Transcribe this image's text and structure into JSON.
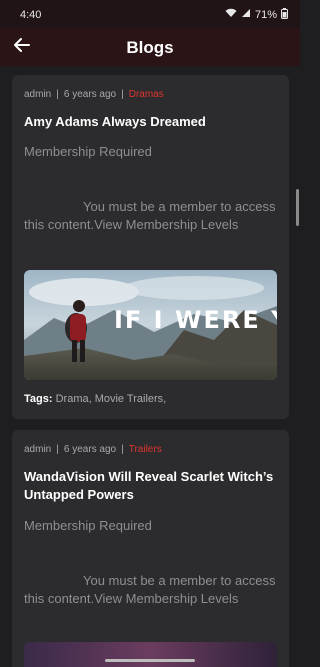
{
  "status": {
    "time": "4:40",
    "battery": "71%",
    "icons": [
      "wifi-icon",
      "signal-icon",
      "battery-icon"
    ]
  },
  "header": {
    "title": "Blogs",
    "back_icon": "arrow-left-icon"
  },
  "posts": [
    {
      "author": "admin",
      "date": "6 years ago",
      "category": "Dramas",
      "title": "Amy Adams Always Dreamed",
      "membership": "Membership Required",
      "access_text": "You must be a member to access this content.",
      "access_link": "View Membership Levels",
      "image_text": "IF I WERE YOU",
      "tags_label": "Tags:",
      "tags": "Drama, Movie Trailers,"
    },
    {
      "author": "admin",
      "date": "6 years ago",
      "category": "Trailers",
      "title": "WandaVision Will Reveal Scarlet Witch’s Untapped Powers",
      "membership": "Membership Required",
      "access_text": "You must be a member to access this content.",
      "access_link": "View Membership Levels"
    }
  ],
  "colors": {
    "accent": "#e0342c",
    "background": "#1e1e20",
    "card": "#2c2c2f",
    "app_bar": "#2a1415"
  }
}
